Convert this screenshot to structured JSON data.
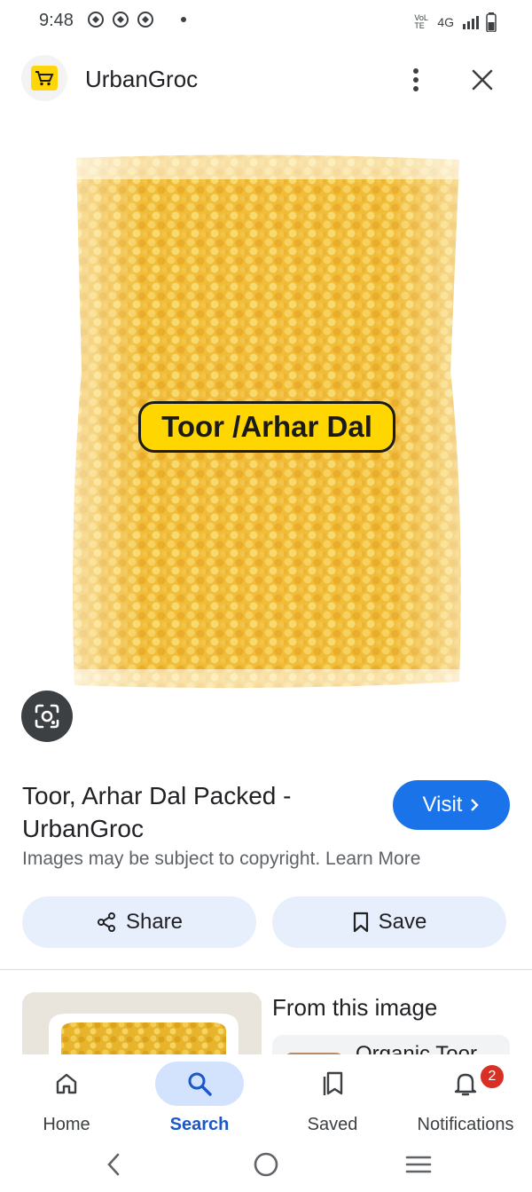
{
  "status_bar": {
    "time": "9:48",
    "network": "4G",
    "volte": "VoLTE"
  },
  "header": {
    "site_name": "UrbanGroc",
    "logo_icon": "shopping-cart-icon",
    "menu_icon": "more-vert-icon",
    "close_icon": "close-icon"
  },
  "image": {
    "label_text": "Toor /Arhar Dal"
  },
  "result": {
    "title": "Toor, Arhar Dal Packed - UrbanGroc",
    "visit_label": "Visit",
    "copyright_text": "Images may be subject to copyright.",
    "learn_more": "Learn More"
  },
  "actions": {
    "share_label": "Share",
    "save_label": "Save"
  },
  "related": {
    "title": "From this image",
    "card_text": "Organic Toor"
  },
  "bottom_nav": {
    "items": [
      {
        "label": "Home",
        "icon": "home-icon"
      },
      {
        "label": "Search",
        "icon": "search-icon"
      },
      {
        "label": "Saved",
        "icon": "saved-icon"
      },
      {
        "label": "Notifications",
        "icon": "bell-icon"
      }
    ],
    "notification_count": "2"
  },
  "colors": {
    "accent": "#1a73e8",
    "pill_bg": "#e8effc",
    "badge": "#d93025",
    "logo_yellow": "#ffd60a"
  }
}
